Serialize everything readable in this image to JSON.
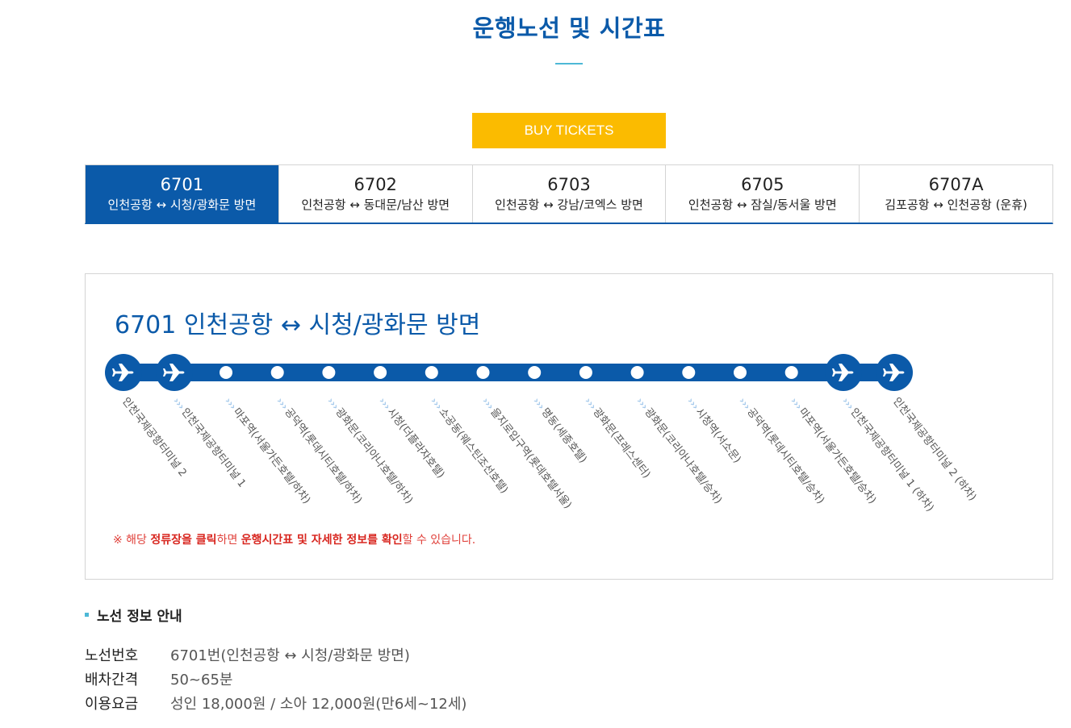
{
  "page_title": "운행노선 및 시간표",
  "buy_button_label": "BUY TICKETS",
  "tabs": [
    {
      "number": "6701",
      "desc": "인천공항 ↔ 시청/광화문 방면",
      "active": true
    },
    {
      "number": "6702",
      "desc": "인천공항 ↔ 동대문/남산 방면",
      "active": false
    },
    {
      "number": "6703",
      "desc": "인천공항 ↔ 강남/코엑스 방면",
      "active": false
    },
    {
      "number": "6705",
      "desc": "인천공항 ↔ 잠실/동서울 방면",
      "active": false
    },
    {
      "number": "6707A",
      "desc": "김포공항 ↔ 인천공항 (운휴)",
      "active": false
    }
  ],
  "route": {
    "heading": "6701 인천공항 ↔ 시청/광화문 방면",
    "stops": [
      {
        "name": "인천국제공항터미널 2",
        "type": "airport"
      },
      {
        "name": "인천국제공항터미널 1",
        "type": "airport"
      },
      {
        "name": "마포역(서울가든호텔/하차)",
        "type": "stop"
      },
      {
        "name": "공덕역(롯데시티호텔/하차)",
        "type": "stop"
      },
      {
        "name": "광화문(코리아나호텔/하차)",
        "type": "stop"
      },
      {
        "name": "시청(더플라자호텔)",
        "type": "stop"
      },
      {
        "name": "소공동(웨스틴조선호텔)",
        "type": "stop"
      },
      {
        "name": "을지로입구역(롯데호텔서울)",
        "type": "stop"
      },
      {
        "name": "명동(세종호텔)",
        "type": "stop"
      },
      {
        "name": "광화문(프레스센터)",
        "type": "stop"
      },
      {
        "name": "광화문(코리아나호텔/승차)",
        "type": "stop"
      },
      {
        "name": "시청역(서소문)",
        "type": "stop"
      },
      {
        "name": "공덕역(롯데시티호텔/승차)",
        "type": "stop"
      },
      {
        "name": "마포역(서울가든호텔/승차)",
        "type": "stop"
      },
      {
        "name": "인천국제공항터미널 1 (하차)",
        "type": "airport"
      },
      {
        "name": "인천국제공항터미널 2 (하차)",
        "type": "airport"
      }
    ],
    "notice": {
      "prefix": "※ 해당 ",
      "bold1": "정류장을 클릭",
      "mid": "하면 ",
      "bold2": "운행시간표 및 자세한 정보를 확인",
      "suffix": "할 수 있습니다."
    }
  },
  "route_info": {
    "title": "노선 정보 안내",
    "rows": [
      {
        "label": "노선번호",
        "value": "6701번(인천공항 ↔ 시청/광화문 방면)"
      },
      {
        "label": "배차간격",
        "value": "50~65분"
      },
      {
        "label": "이용요금",
        "value": "성인 18,000원 / 소아 12,000원(만6세~12세)"
      }
    ]
  },
  "colors": {
    "primary": "#0b5aa9",
    "accent_yellow": "#fbbb00",
    "notice_red": "#e0413b",
    "underline_cyan": "#4db8d6"
  }
}
